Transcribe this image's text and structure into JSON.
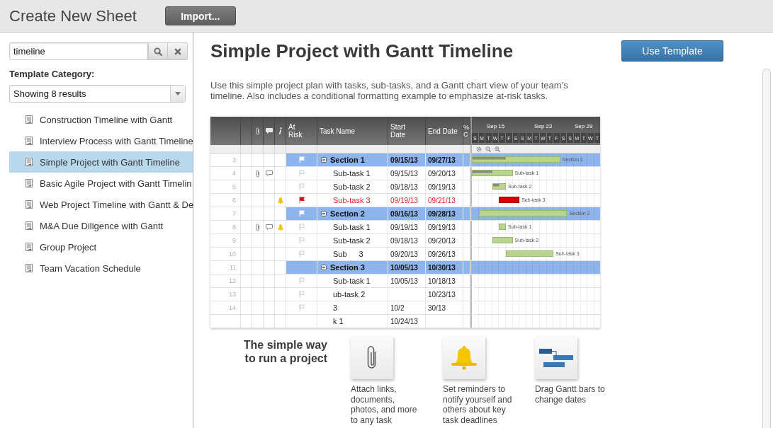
{
  "header": {
    "title": "Create New Sheet",
    "import_button": "Import..."
  },
  "sidebar": {
    "search": {
      "value": "timeline"
    },
    "category_label": "Template Category:",
    "category_select": "Showing 8 results",
    "items": [
      {
        "label": "Construction Timeline with Gantt",
        "selected": false
      },
      {
        "label": "Interview Process with Gantt Timeline",
        "selected": false
      },
      {
        "label": "Simple Project with Gantt Timeline",
        "selected": true
      },
      {
        "label": "Basic Agile Project with Gantt Timelin",
        "selected": false
      },
      {
        "label": "Web Project Timeline with Gantt & De",
        "selected": false
      },
      {
        "label": "M&A Due Diligence with Gantt",
        "selected": false
      },
      {
        "label": "Group Project",
        "selected": false
      },
      {
        "label": "Team Vacation Schedule",
        "selected": false
      }
    ]
  },
  "template": {
    "title": "Simple Project with Gantt Timeline",
    "use_button": "Use Template",
    "description": "Use this simple project plan with tasks, sub-tasks, and a Gantt chart view of your team’s timeline. Also includes a conditional formatting example to emphasize at-risk tasks.",
    "preview": {
      "columns": [
        "At Risk",
        "Task Name",
        "Start Date",
        "End Date",
        "% C"
      ],
      "weeks": [
        "Sep 15",
        "Sep 22",
        "Sep 29"
      ],
      "days": [
        "S",
        "M",
        "T",
        "W",
        "T",
        "F",
        "S",
        "S",
        "M",
        "T",
        "W",
        "T",
        "F",
        "S",
        "S",
        "M",
        "T",
        "W",
        "T"
      ],
      "rows": [
        {
          "number": "3",
          "kind": "section",
          "task": "Section 1",
          "start": "09/15/13",
          "end": "09/27/13",
          "at_risk": false,
          "flag": true,
          "attachment": false,
          "comment": false,
          "reminder": false,
          "bar_label": "Section 1"
        },
        {
          "number": "4",
          "kind": "task",
          "task": "Sub-task 1",
          "start": "09/15/13",
          "end": "09/20/13",
          "at_risk": false,
          "flag": true,
          "attachment": true,
          "comment": true,
          "reminder": false,
          "bar_label": "Sub-task 1"
        },
        {
          "number": "5",
          "kind": "task",
          "task": "Sub-task 2",
          "start": "09/18/13",
          "end": "09/19/13",
          "at_risk": false,
          "flag": true,
          "attachment": false,
          "comment": false,
          "reminder": false,
          "bar_label": "Sub-task 2"
        },
        {
          "number": "6",
          "kind": "task",
          "task": "Sub-task 3",
          "start": "09/19/13",
          "end": "09/21/13",
          "at_risk": true,
          "flag": true,
          "attachment": false,
          "comment": false,
          "reminder": true,
          "bar_label": "Sub-task 3"
        },
        {
          "number": "7",
          "kind": "section",
          "task": "Section 2",
          "start": "09/16/13",
          "end": "09/28/13",
          "at_risk": false,
          "flag": true,
          "attachment": false,
          "comment": false,
          "reminder": false,
          "bar_label": "Section 2"
        },
        {
          "number": "8",
          "kind": "task",
          "task": "Sub-task 1",
          "start": "09/19/13",
          "end": "09/19/13",
          "at_risk": false,
          "flag": true,
          "attachment": true,
          "comment": true,
          "reminder": true,
          "bar_label": "Sub-task 1"
        },
        {
          "number": "9",
          "kind": "task",
          "task": "Sub-task 2",
          "start": "09/18/13",
          "end": "09/20/13",
          "at_risk": false,
          "flag": true,
          "attachment": false,
          "comment": false,
          "reminder": false,
          "bar_label": "Sub-task 2"
        },
        {
          "number": "10",
          "kind": "task",
          "task": [
            "Sub",
            "3"
          ],
          "start": "09/20/13",
          "end": "09/26/13",
          "at_risk": false,
          "flag": true,
          "attachment": false,
          "comment": false,
          "reminder": false,
          "bar_label": "Sub-task 3"
        },
        {
          "number": "11",
          "kind": "section",
          "task": "Section 3",
          "start": "10/05/13",
          "end": "10/30/13",
          "at_risk": false,
          "flag": false,
          "attachment": false,
          "comment": false,
          "reminder": false
        },
        {
          "number": "12",
          "kind": "task",
          "task": "Sub-task 1",
          "start": "10/05/13",
          "end": "10/18/13",
          "at_risk": false,
          "flag": true,
          "attachment": false,
          "comment": false,
          "reminder": false
        },
        {
          "number": "13",
          "kind": "task",
          "task": "ub-task 2",
          "end": "10/23/13",
          "at_risk": false,
          "flag": true,
          "attachment": false,
          "comment": false,
          "reminder": false
        },
        {
          "number": "14",
          "kind": "task",
          "task": "3",
          "start": "10/2",
          "end": "30/13",
          "at_risk": false,
          "flag": true,
          "attachment": false,
          "comment": false,
          "reminder": false
        },
        {
          "kind": "task",
          "task": "k 1",
          "start": "10/24/13",
          "at_risk": false,
          "flag": false,
          "attachment": false,
          "comment": false,
          "reminder": false
        }
      ]
    },
    "tagline": "The simple way\nto run a project",
    "features": [
      {
        "kind": "attachment",
        "caption": "Attach links,\ndocuments,\nphotos, and more\nto any task"
      },
      {
        "kind": "reminder",
        "caption": "Set reminders to\nnotify yourself and\nothers about key\ntask deadlines"
      },
      {
        "kind": "gantt",
        "caption": "Drag Gantt bars to\nchange dates"
      }
    ]
  }
}
